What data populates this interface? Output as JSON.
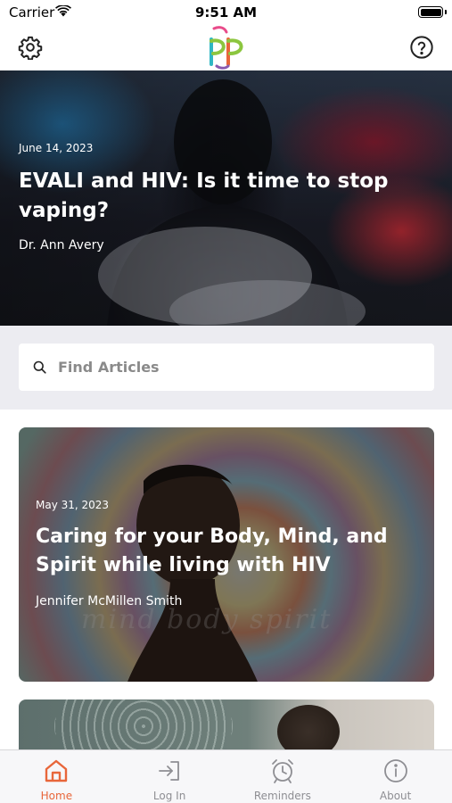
{
  "status_bar": {
    "carrier": "Carrier",
    "time": "9:51 AM"
  },
  "nav": {
    "settings_icon": "gear-icon",
    "help_icon": "question-circle-icon",
    "logo": "pp"
  },
  "featured": {
    "date": "June 14, 2023",
    "title": "EVALI and HIV: Is it time to stop vaping?",
    "author": "Dr. Ann Avery"
  },
  "search": {
    "placeholder": "Find Articles",
    "value": ""
  },
  "articles": [
    {
      "date": "May 31, 2023",
      "title": "Caring for your Body, Mind, and Spirit while living with HIV",
      "author": "Jennifer McMillen Smith",
      "image_text": "mind body spirit"
    }
  ],
  "tabs": [
    {
      "label": "Home",
      "icon": "home-icon",
      "active": true
    },
    {
      "label": "Log In",
      "icon": "login-icon",
      "active": false
    },
    {
      "label": "Reminders",
      "icon": "alarm-clock-icon",
      "active": false
    },
    {
      "label": "About",
      "icon": "info-icon",
      "active": false
    }
  ],
  "colors": {
    "accent": "#e8663a",
    "tab_inactive": "#8e8e93",
    "search_bg": "#ececf1"
  }
}
